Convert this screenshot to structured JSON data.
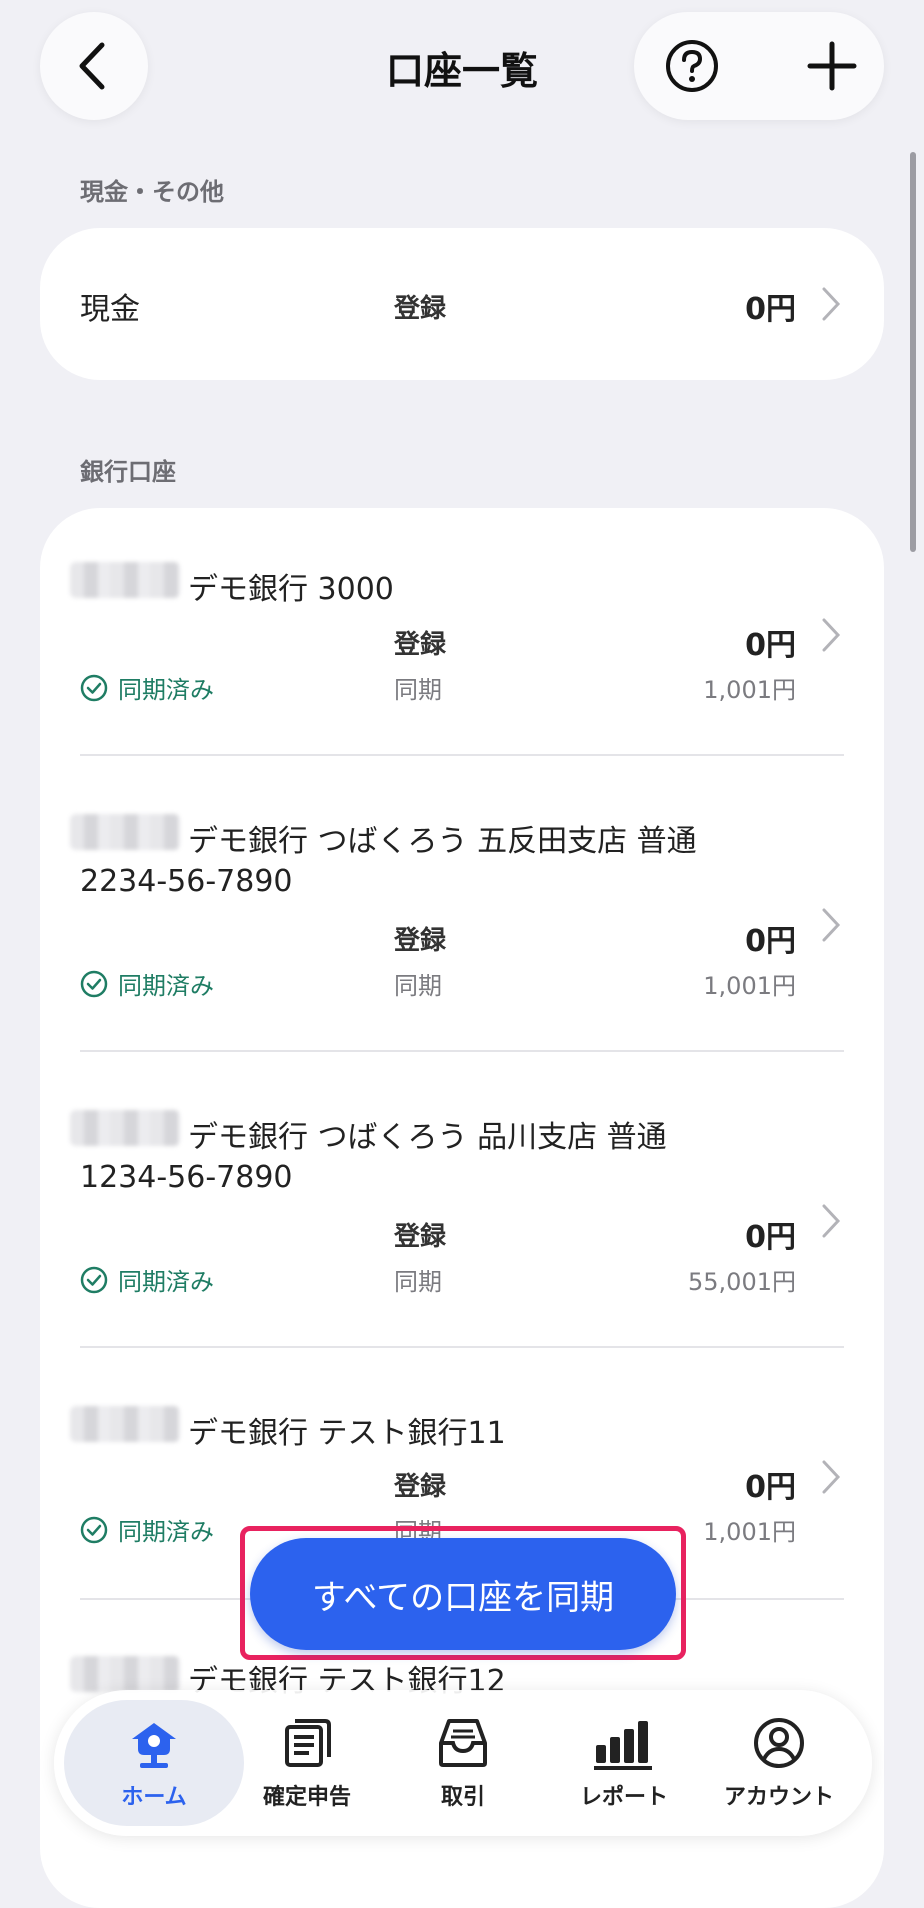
{
  "header": {
    "title": "口座一覧"
  },
  "sections": {
    "cash": {
      "label": "現金・その他",
      "row": {
        "name": "現金",
        "status": "登録",
        "amount": "0円"
      }
    },
    "bank": {
      "label": "銀行口座",
      "accounts": [
        {
          "name_line1": "デモ銀行 3000",
          "name_line2": "",
          "registered_label": "登録",
          "registered_amount": "0円",
          "sync_status": "同期済み",
          "synced_label": "同期",
          "synced_amount": "1,001円"
        },
        {
          "name_line1": "デモ銀行 つばくろう 五反田支店 普通",
          "name_line2": "2234-56-7890",
          "registered_label": "登録",
          "registered_amount": "0円",
          "sync_status": "同期済み",
          "synced_label": "同期",
          "synced_amount": "1,001円"
        },
        {
          "name_line1": "デモ銀行 つばくろう 品川支店 普通",
          "name_line2": "1234-56-7890",
          "registered_label": "登録",
          "registered_amount": "0円",
          "sync_status": "同期済み",
          "synced_label": "同期",
          "synced_amount": "55,001円"
        },
        {
          "name_line1": "デモ銀行 テスト銀行11",
          "name_line2": "",
          "registered_label": "登録",
          "registered_amount": "0円",
          "sync_status": "同期済み",
          "synced_label": "同期",
          "synced_amount": "1,001円"
        },
        {
          "name_line1": "デモ銀行 テスト銀行12",
          "name_line2": "",
          "registered_label": "",
          "registered_amount": "",
          "sync_status": "",
          "synced_label": "",
          "synced_amount": ""
        }
      ]
    }
  },
  "sync_all_button": {
    "label": "すべての口座を同期"
  },
  "tabbar": {
    "tabs": [
      {
        "label": "ホーム",
        "icon": "home-icon",
        "active": true
      },
      {
        "label": "確定申告",
        "icon": "tax-return-icon",
        "active": false
      },
      {
        "label": "取引",
        "icon": "transactions-icon",
        "active": false
      },
      {
        "label": "レポート",
        "icon": "report-icon",
        "active": false
      },
      {
        "label": "アカウント",
        "icon": "account-icon",
        "active": false
      }
    ]
  },
  "colors": {
    "accent": "#2c62ee",
    "sync_ok": "#1f7d64",
    "highlight": "#e8225f",
    "background": "#f0f0f5"
  }
}
